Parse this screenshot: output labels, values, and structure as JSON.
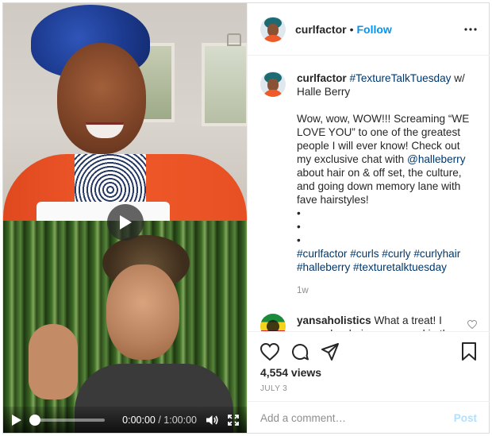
{
  "header": {
    "username": "curlfactor",
    "separator": "•",
    "follow_label": "Follow"
  },
  "video": {
    "current_time": "0:00:00",
    "duration_text": " / 1:00:00",
    "progress_fraction": 0
  },
  "caption": {
    "username": "curlfactor",
    "title_hashtag": "#TextureTalkTuesday",
    "title_rest": " w/ Halle Berry",
    "text_before": "Wow, wow, WOW!!! Screaming “WE LOVE YOU” to one of the greatest people I will ever know! Check out my exclusive chat with ",
    "mention": "@halleberry",
    "text_after": " about hair on & off set, the culture, and going down memory lane with fave hairstyles!",
    "bullets": [
      "•",
      "•",
      "•"
    ],
    "hashtags": [
      "#curlfactor",
      "#curls",
      "#curly",
      "#curlyhair",
      "#halleberry",
      "#texturetalktuesday"
    ],
    "time": "1w"
  },
  "comment": {
    "username": "yansaholistics",
    "text": " What a treat! I remember being so moved in the first grade when I saw Halle Berry"
  },
  "actions": {
    "views": "4,554 views",
    "date": "JULY 3"
  },
  "add_comment": {
    "placeholder": "Add a comment…",
    "post_label": "Post"
  },
  "colors": {
    "link_blue": "#0095f6",
    "hashtag": "#00376b",
    "post_disabled": "#b2dffc",
    "muted": "#8e8e8e"
  },
  "icons": [
    "play-icon",
    "volume-icon",
    "fullscreen-icon",
    "more-icon",
    "heart-icon",
    "comment-icon",
    "share-icon",
    "bookmark-icon"
  ]
}
